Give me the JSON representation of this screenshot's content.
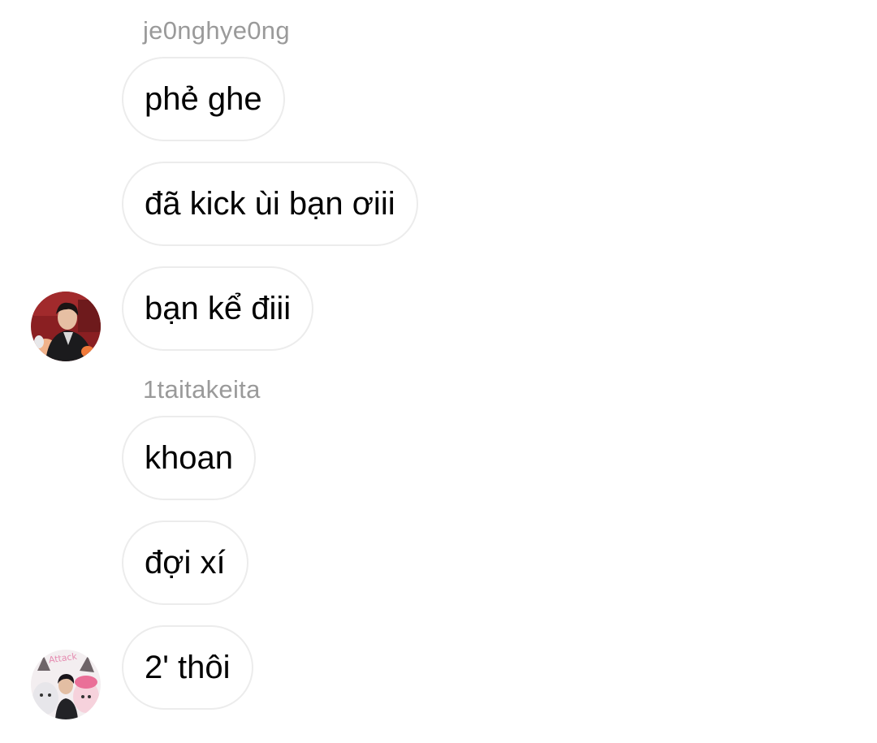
{
  "groups": [
    {
      "sender": "je0nghye0ng",
      "messages": [
        "phẻ ghe",
        "đã kick ùi bạn ơiii",
        "bạn kể điii"
      ],
      "avatar_icon": "user-photo-avatar"
    },
    {
      "sender": "1taitakeita",
      "messages": [
        "khoan",
        "đợi xí",
        "2' thôi"
      ],
      "avatar_icon": "user-photo-avatar",
      "avatar_caption": "Attack"
    }
  ],
  "colors": {
    "sender_text": "#9a9a9a",
    "bubble_border": "#ececec",
    "message_text": "#000000",
    "background": "#ffffff"
  }
}
